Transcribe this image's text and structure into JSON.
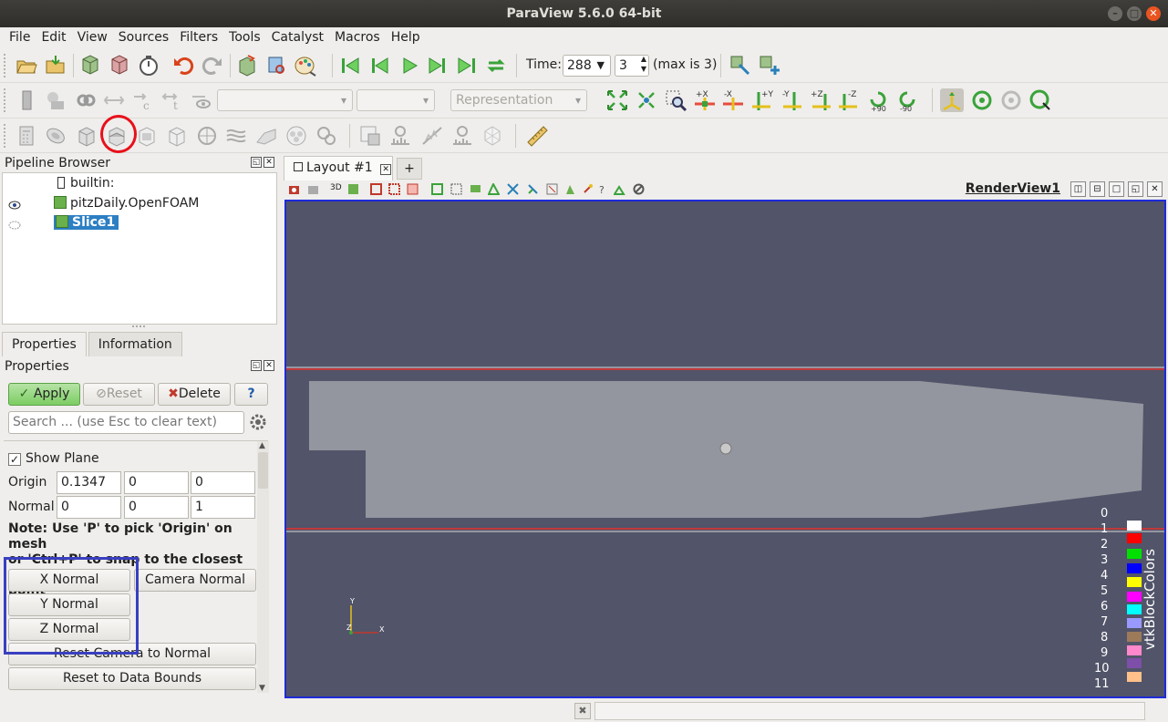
{
  "window": {
    "title": "ParaView 5.6.0 64-bit"
  },
  "menu": [
    "File",
    "Edit",
    "View",
    "Sources",
    "Filters",
    "Tools",
    "Catalyst",
    "Macros",
    "Help"
  ],
  "time": {
    "label": "Time:",
    "value": "288",
    "index": "3",
    "max_text": "(max is 3)"
  },
  "representation": {
    "placeholder": "Representation"
  },
  "pipeline": {
    "title": "Pipeline Browser",
    "items": [
      "builtin:",
      "pitzDaily.OpenFOAM",
      "Slice1"
    ]
  },
  "tabs": {
    "properties": "Properties",
    "information": "Information"
  },
  "properties": {
    "title": "Properties",
    "apply": "Apply",
    "reset": "Reset",
    "delete": "Delete",
    "help": "?",
    "search_placeholder": "Search ... (use Esc to clear text)",
    "show_plane_label": "Show Plane",
    "show_plane_checked": true,
    "origin_label": "Origin",
    "origin": [
      "0.1347",
      "0",
      "0"
    ],
    "normal_label": "Normal",
    "normal": [
      "0",
      "0",
      "1"
    ],
    "note_line1": "Note: Use 'P' to pick 'Origin' on mesh",
    "note_line2": "or 'Ctrl+P' to snap to the closest mesh",
    "note_line3": "point",
    "x_normal": "X Normal",
    "y_normal": "Y Normal",
    "z_normal": "Z Normal",
    "camera_normal": "Camera Normal",
    "reset_camera": "Reset Camera to Normal",
    "reset_bounds": "Reset to Data Bounds"
  },
  "layout": {
    "tab": "Layout #1",
    "plus": "+",
    "view_name": "RenderView1",
    "three_d": "3D"
  },
  "legend": {
    "title": "vtkBlockColors",
    "labels": [
      "0",
      "1",
      "2",
      "3",
      "4",
      "5",
      "6",
      "7",
      "8",
      "9",
      "10",
      "11"
    ],
    "colors": [
      "#ffffff",
      "#ff0000",
      "#00e000",
      "#0000ff",
      "#ffff00",
      "#ff00ff",
      "#00ffff",
      "#9999ff",
      "#9d7a5a",
      "#ff88cc",
      "#7d4fa8",
      "#ffc08a"
    ]
  },
  "axes": {
    "x": "X",
    "y": "Y",
    "z": "Z"
  },
  "colors": {
    "render_bg": "#525469",
    "mesh": "#94969f",
    "highlight": "#1e2bd8",
    "slice_selected": "#2d7fc3"
  }
}
